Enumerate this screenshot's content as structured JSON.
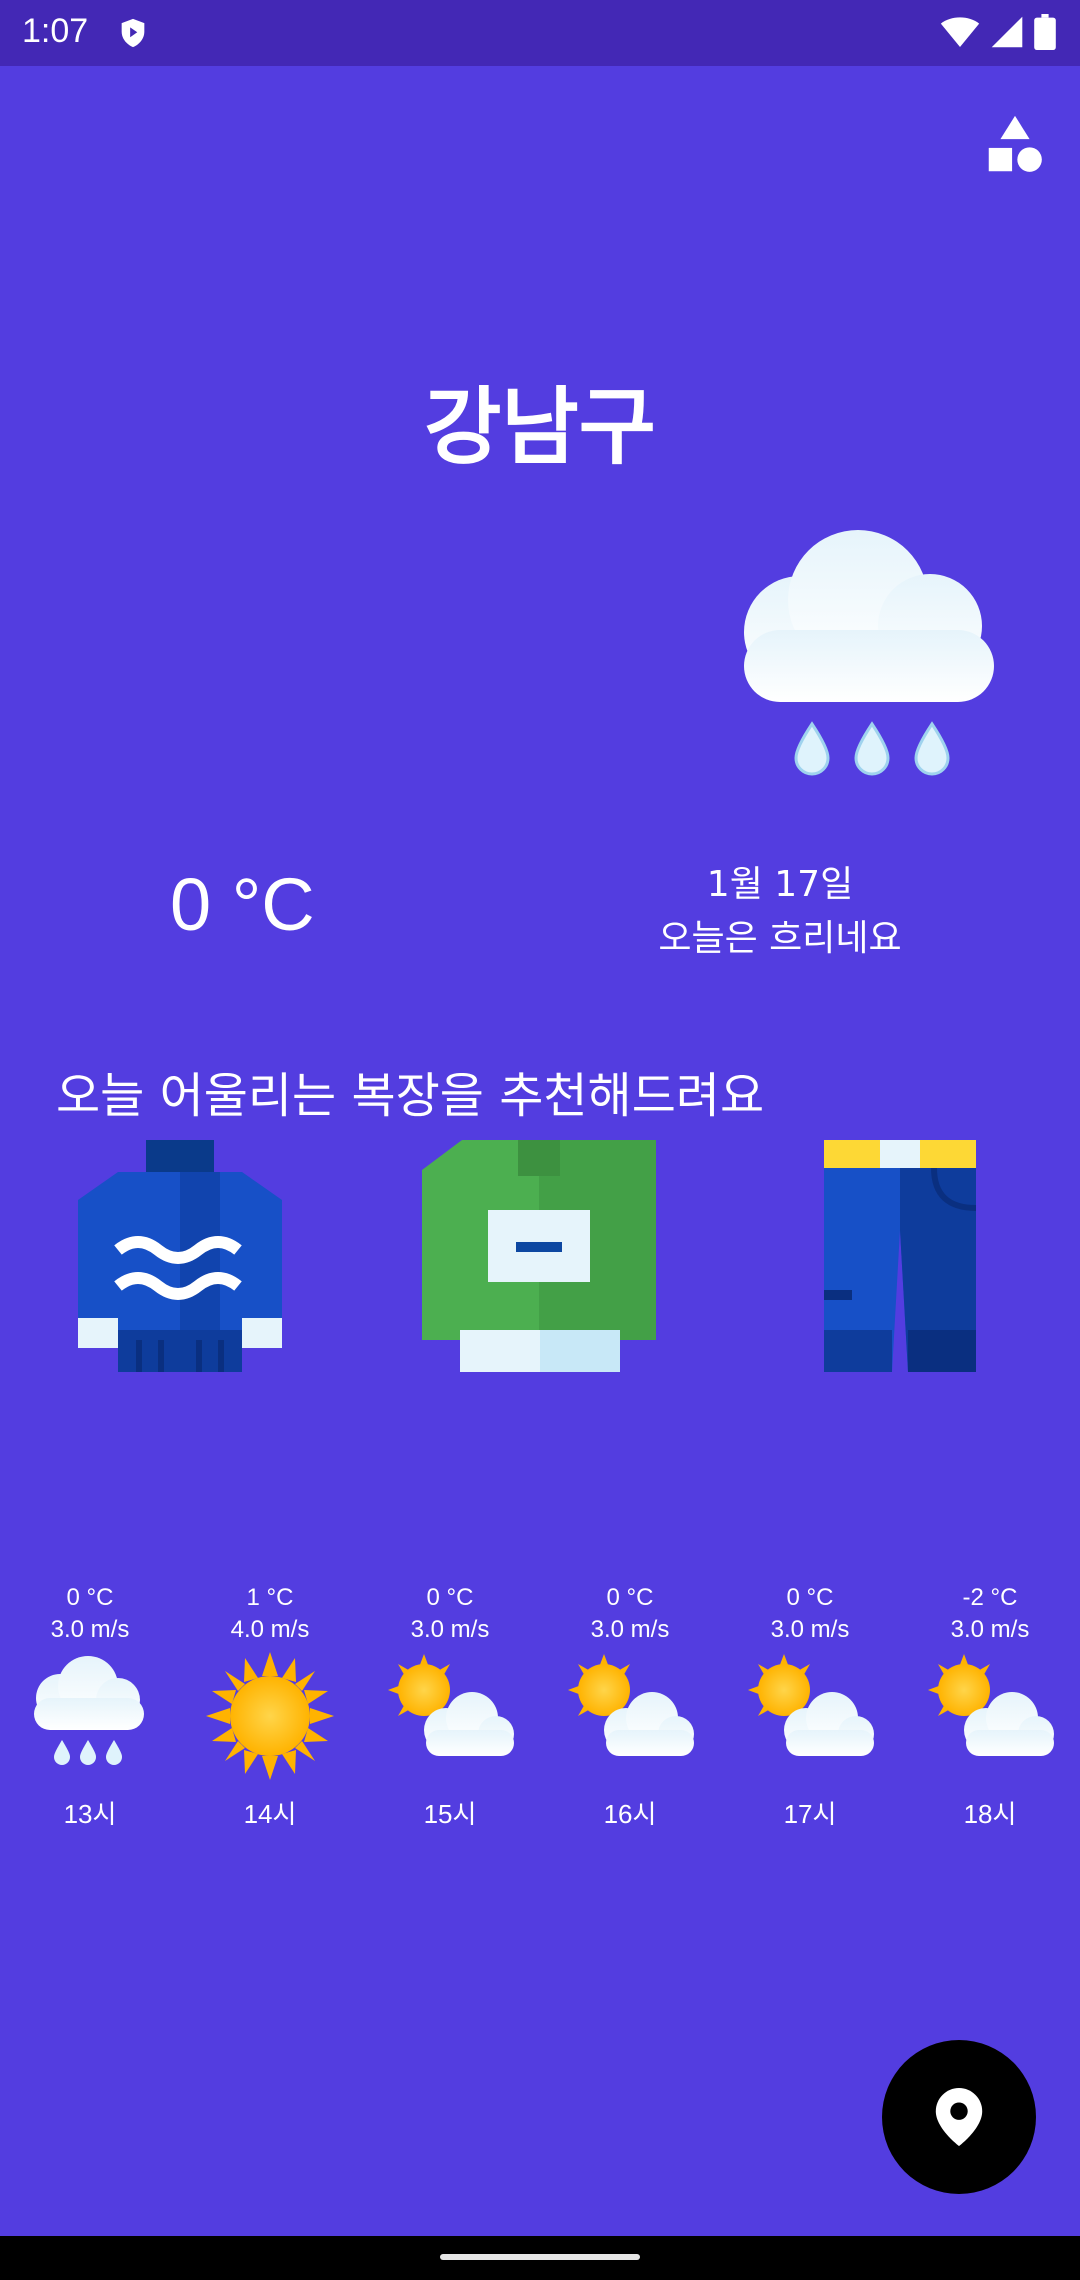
{
  "status_bar": {
    "time": "1:07"
  },
  "header": {
    "city": "강남구"
  },
  "current": {
    "temperature": "0 °C",
    "date": "1월 17일",
    "description": "오늘은 흐리네요",
    "icon": "rain-cloud-icon"
  },
  "recommend": {
    "title": "오늘 어울리는 복장을 추천해드려요",
    "items": [
      "blue-knit-sweater-icon",
      "green-sweatshirt-icon",
      "jeans-icon"
    ]
  },
  "forecast": [
    {
      "temp": "0 °C",
      "wind": "3.0 m/s",
      "hour": "13시",
      "icon": "rain-cloud-icon"
    },
    {
      "temp": "1 °C",
      "wind": "4.0 m/s",
      "hour": "14시",
      "icon": "sun-icon"
    },
    {
      "temp": "0 °C",
      "wind": "3.0 m/s",
      "hour": "15시",
      "icon": "partly-cloudy-icon"
    },
    {
      "temp": "0 °C",
      "wind": "3.0 m/s",
      "hour": "16시",
      "icon": "partly-cloudy-icon"
    },
    {
      "temp": "0 °C",
      "wind": "3.0 m/s",
      "hour": "17시",
      "icon": "partly-cloudy-icon"
    },
    {
      "temp": "-2 °C",
      "wind": "3.0 m/s",
      "hour": "18시",
      "icon": "partly-cloudy-icon"
    }
  ],
  "colors": {
    "background": "#533de0",
    "status_bar": "#4328b5",
    "fab": "#000000"
  }
}
